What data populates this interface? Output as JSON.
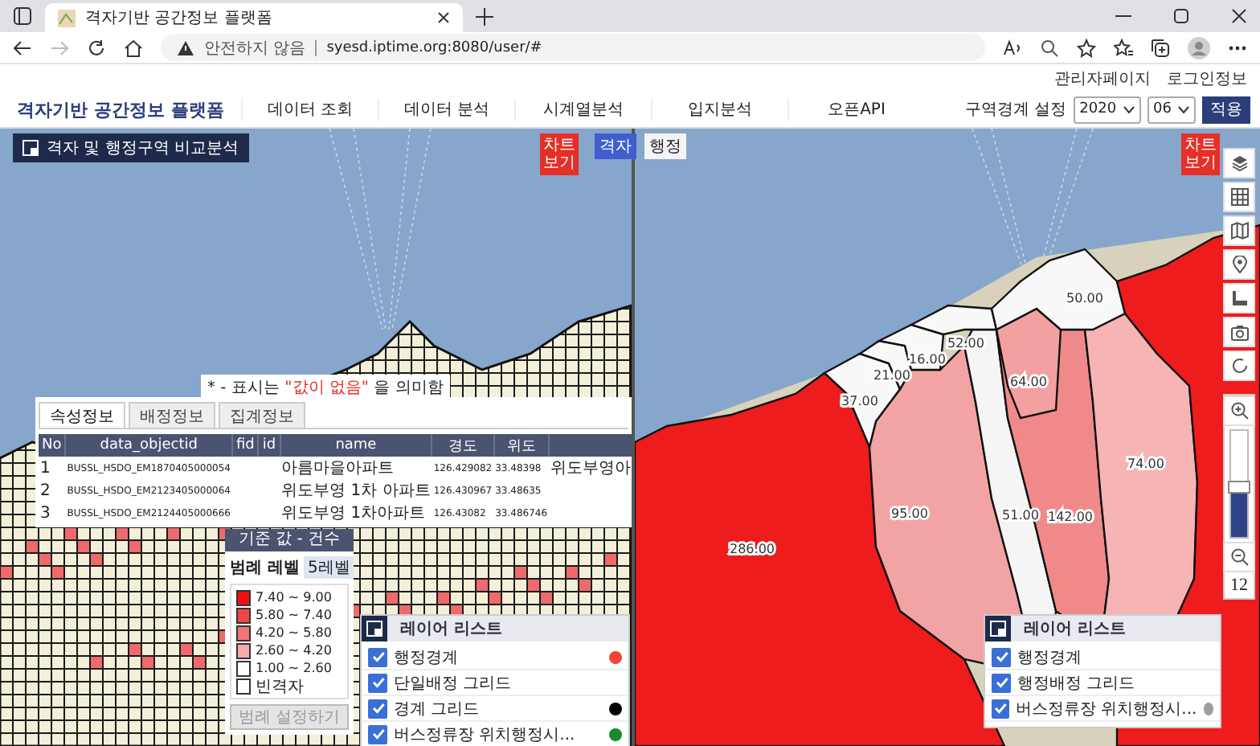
{
  "browser": {
    "tab_title": "격자기반 공간정보 플랫폼",
    "security": "안전하지 않음",
    "url": "syesd.iptime.org:8080/user/#"
  },
  "top_links": [
    "관리자페이지",
    "로그인정보"
  ],
  "nav": {
    "logo": "격자기반 공간정보 플랫폼",
    "items": [
      "데이터 조회",
      "데이터 분석",
      "시계열분석",
      "입지분석",
      "오픈API"
    ],
    "boundary_label": "구역경계 설정",
    "year": "2020",
    "month": "06",
    "apply": "적용"
  },
  "view_toggle": [
    {
      "label": "격자",
      "selected": true
    },
    {
      "label": "행정",
      "selected": false
    }
  ],
  "left_map": {
    "compare_button": "격자 및 행정구역 비교분석",
    "chart_button": "차트 보기",
    "note": "* - 표시는 **\"값이 없음\"** 을 의미함",
    "popup": {
      "tabs": [
        {
          "label": "속성정보",
          "selected": true
        },
        {
          "label": "배정정보",
          "selected": false
        },
        {
          "label": "집계정보",
          "selected": false
        }
      ],
      "columns": [
        "No",
        "data_objectid",
        "fid",
        "id",
        "name",
        "경도",
        "위도"
      ],
      "rows": [
        {
          "no": "1",
          "data_objectid": "BUSSL_HSDO_EM1870405000054",
          "name": "아름마을아파트",
          "longitude": "126.429082",
          "latitude": "33.48398",
          "column_8": "위도부영아"
        },
        {
          "no": "2",
          "data_objectid": "BUSSL_HSDO_EM2123405000064",
          "name": "위도부영 1차 아파트",
          "longitude": "126.430967",
          "latitude": "33.48635"
        },
        {
          "no": "3",
          "data_objectid": "BUSSL_HSDO_EM2124405000666",
          "name": "위도부영 1차아파트",
          "longitude": "126.43082",
          "latitude": "33.486746"
        }
      ]
    },
    "legend": {
      "title": "기준 값 - 건수",
      "level_label": "범례 레벨",
      "level_value": "5레벨",
      "items": [
        {
          "label": "7.40 ~ 9.00",
          "color": "#ee1111"
        },
        {
          "label": "5.80 ~ 7.40",
          "color": "#f04848"
        },
        {
          "label": "4.20 ~ 5.80",
          "color": "#f27676"
        },
        {
          "label": "2.60 ~ 4.20",
          "color": "#f7aaaa"
        },
        {
          "label": "1.00 ~ 2.60",
          "color": "#ffffff"
        },
        {
          "label": "빈격자",
          "color": "#ffffff"
        }
      ],
      "button": {
        "label": "범례 설정하기",
        "disabled": true
      }
    },
    "layers": {
      "title": "레이어 리스트",
      "items": [
        {
          "label": "행정경계",
          "checked": true,
          "color": "#f44336"
        },
        {
          "label": "단일배정 그리드",
          "checked": true
        },
        {
          "label": "경계 그리드",
          "checked": true,
          "color": "#000000"
        },
        {
          "label": "버스정류장 위치행정시...",
          "checked": true,
          "color": "#1a8a2e"
        }
      ]
    }
  },
  "right_map": {
    "chart_button": "차트 보기",
    "regions": [
      {
        "label": "286.00",
        "color": "#ee1c1c"
      },
      {
        "label": "95.00",
        "color": "#f2a3a3"
      },
      {
        "label": "51.00",
        "color": "#f5f5f5"
      },
      {
        "label": "142.00",
        "color": "#f08a8a"
      },
      {
        "label": "74.00",
        "color": "#f6b4b4"
      },
      {
        "label": "37.00",
        "color": "#f8f8f8"
      },
      {
        "label": "21.00",
        "color": "#f8f8f8"
      },
      {
        "label": "16.00",
        "color": "#f8f8f8"
      },
      {
        "label": "52.00",
        "color": "#f8f8f8"
      },
      {
        "label": "64.00",
        "color": "#f2a0a0"
      },
      {
        "label": "50.00",
        "color": "#f8f8f8"
      },
      {
        "color": "#ee1c1c"
      }
    ],
    "zoom": {
      "level": 0.45,
      "value": "12"
    },
    "layers": {
      "title": "레이어 리스트",
      "items": [
        {
          "label": "행정경계",
          "checked": true
        },
        {
          "label": "행정배정 그리드",
          "checked": true
        },
        {
          "label": "버스정류장 위치행정시...",
          "checked": true,
          "color": "#9e9e9e"
        }
      ]
    }
  }
}
